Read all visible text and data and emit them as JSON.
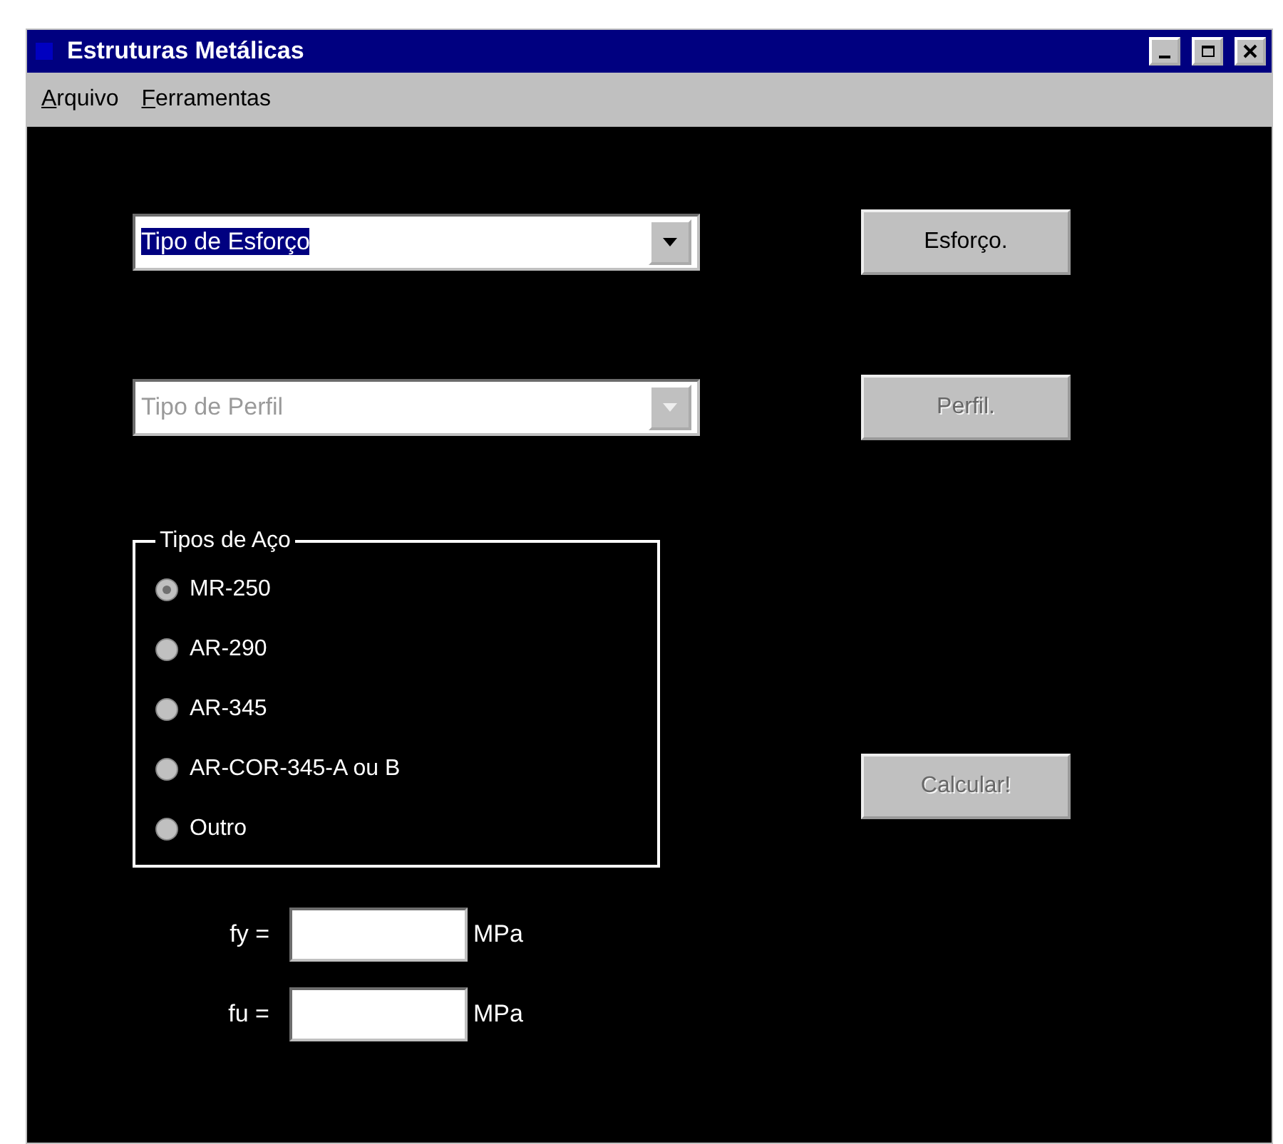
{
  "window": {
    "title": "Estruturas Metálicas"
  },
  "menu": [
    {
      "label": "Arquivo",
      "first_letter_underlined": true
    },
    {
      "label": "Ferramentas",
      "first_letter_underlined": true
    }
  ],
  "combos": [
    {
      "value": "Tipo de Esforço",
      "selected": true,
      "disabled": false,
      "button": {
        "label": "Esforço.",
        "disabled": false
      }
    },
    {
      "value": "Tipo de Perfil",
      "selected": false,
      "disabled": true,
      "button": {
        "label": "Perfil.",
        "disabled": true
      }
    }
  ],
  "steel_group": {
    "title": "Tipos de Aço",
    "options": [
      {
        "label": "MR-250",
        "selected": true
      },
      {
        "label": "AR-290",
        "selected": false
      },
      {
        "label": "AR-345",
        "selected": false
      },
      {
        "label": "AR-COR-345-A ou B",
        "selected": false
      },
      {
        "label": "Outro",
        "selected": false
      }
    ]
  },
  "calculate_button": {
    "label": "Calcular!",
    "disabled": true
  },
  "fields": [
    {
      "label": "fy =",
      "unit": "MPa"
    },
    {
      "label": "fu =",
      "unit": "MPa"
    }
  ]
}
